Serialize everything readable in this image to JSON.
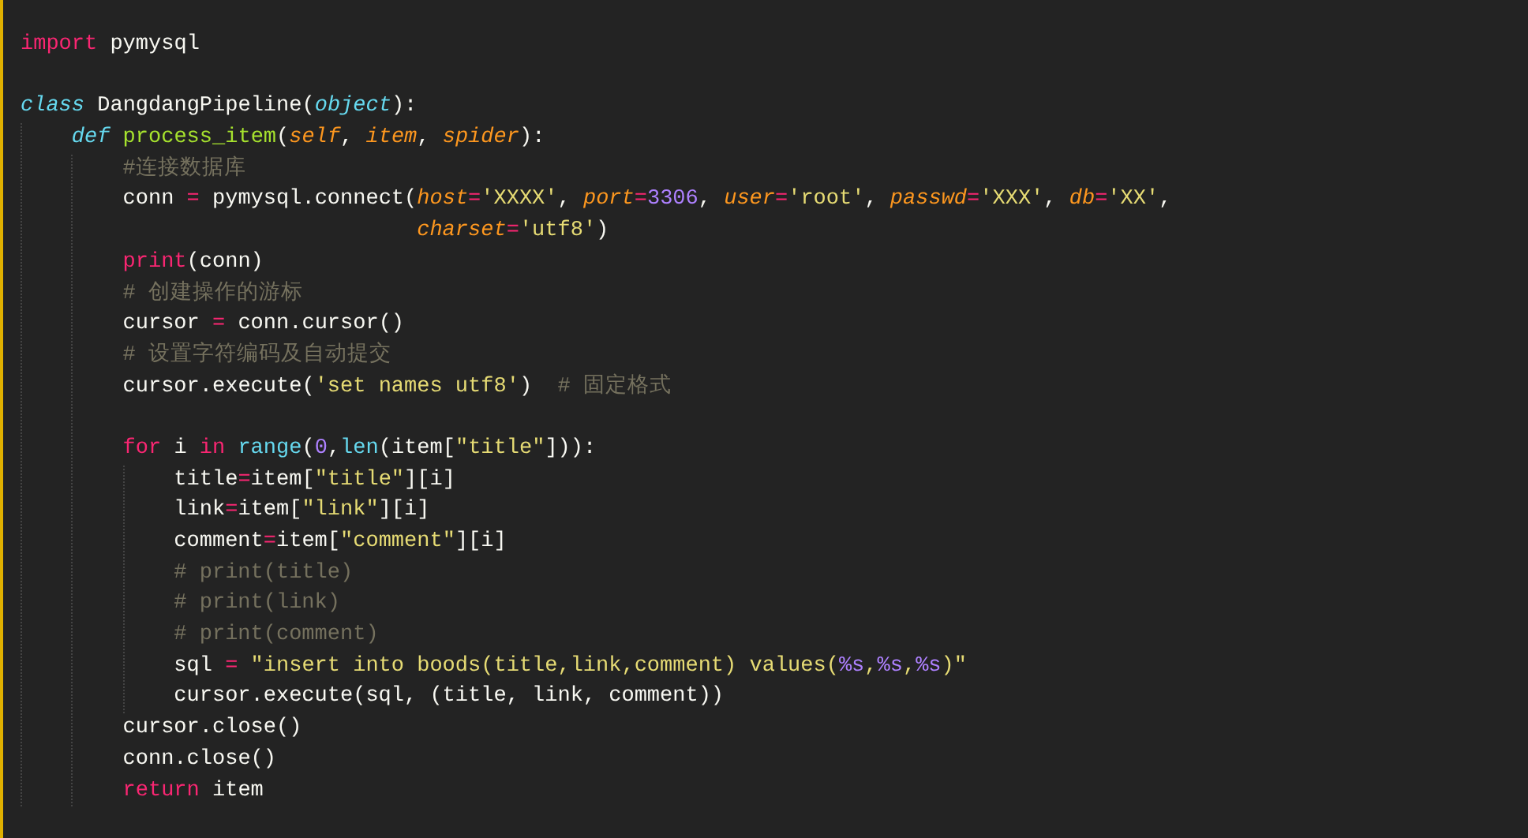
{
  "editor": {
    "lines": [
      {
        "kind": "code",
        "tokens": [
          {
            "kind": "keyword",
            "text": "import"
          },
          {
            "kind": "plain",
            "text": " pymysql"
          }
        ]
      },
      {
        "kind": "blank"
      },
      {
        "kind": "code",
        "tokens": [
          {
            "kind": "storage",
            "text": "class"
          },
          {
            "kind": "plain",
            "text": " DangdangPipeline("
          },
          {
            "kind": "type",
            "text": "object"
          },
          {
            "kind": "plain",
            "text": "):"
          }
        ],
        "children": [
          {
            "kind": "code",
            "tokens": [
              {
                "kind": "storage",
                "text": "def"
              },
              {
                "kind": "function",
                "text": " process_item"
              },
              {
                "kind": "plain",
                "text": "("
              },
              {
                "kind": "param",
                "text": "self"
              },
              {
                "kind": "plain",
                "text": ", "
              },
              {
                "kind": "param",
                "text": "item"
              },
              {
                "kind": "plain",
                "text": ", "
              },
              {
                "kind": "param",
                "text": "spider"
              },
              {
                "kind": "plain",
                "text": "):"
              }
            ],
            "children": [
              {
                "kind": "code",
                "tokens": [
                  {
                    "kind": "comment",
                    "text": "#连接数据库"
                  }
                ]
              },
              {
                "kind": "code",
                "tokens": [
                  {
                    "kind": "plain",
                    "text": "conn "
                  },
                  {
                    "kind": "operator",
                    "text": "="
                  },
                  {
                    "kind": "plain",
                    "text": " pymysql.connect("
                  },
                  {
                    "kind": "param",
                    "text": "host"
                  },
                  {
                    "kind": "operator",
                    "text": "="
                  },
                  {
                    "kind": "string",
                    "text": "'XXXX'"
                  },
                  {
                    "kind": "plain",
                    "text": ", "
                  },
                  {
                    "kind": "param",
                    "text": "port"
                  },
                  {
                    "kind": "operator",
                    "text": "="
                  },
                  {
                    "kind": "number",
                    "text": "3306"
                  },
                  {
                    "kind": "plain",
                    "text": ", "
                  },
                  {
                    "kind": "param",
                    "text": "user"
                  },
                  {
                    "kind": "operator",
                    "text": "="
                  },
                  {
                    "kind": "string",
                    "text": "'root'"
                  },
                  {
                    "kind": "plain",
                    "text": ", "
                  },
                  {
                    "kind": "param",
                    "text": "passwd"
                  },
                  {
                    "kind": "operator",
                    "text": "="
                  },
                  {
                    "kind": "string",
                    "text": "'XXX'"
                  },
                  {
                    "kind": "plain",
                    "text": ", "
                  },
                  {
                    "kind": "param",
                    "text": "db"
                  },
                  {
                    "kind": "operator",
                    "text": "="
                  },
                  {
                    "kind": "string",
                    "text": "'XX'"
                  },
                  {
                    "kind": "plain",
                    "text": ","
                  }
                ]
              },
              {
                "kind": "continuation",
                "tokens": [
                  {
                    "kind": "param",
                    "text": "charset"
                  },
                  {
                    "kind": "operator",
                    "text": "="
                  },
                  {
                    "kind": "string",
                    "text": "'utf8'"
                  },
                  {
                    "kind": "plain",
                    "text": ")"
                  }
                ]
              },
              {
                "kind": "code",
                "tokens": [
                  {
                    "kind": "builtin",
                    "text": "print"
                  },
                  {
                    "kind": "plain",
                    "text": "(conn)"
                  }
                ]
              },
              {
                "kind": "code",
                "tokens": [
                  {
                    "kind": "comment",
                    "text": "# 创建操作的游标"
                  }
                ]
              },
              {
                "kind": "code",
                "tokens": [
                  {
                    "kind": "plain",
                    "text": "cursor "
                  },
                  {
                    "kind": "operator",
                    "text": "="
                  },
                  {
                    "kind": "plain",
                    "text": " conn.cursor()"
                  }
                ]
              },
              {
                "kind": "code",
                "tokens": [
                  {
                    "kind": "comment",
                    "text": "# 设置字符编码及自动提交"
                  }
                ]
              },
              {
                "kind": "code",
                "tokens": [
                  {
                    "kind": "plain",
                    "text": "cursor.execute("
                  },
                  {
                    "kind": "string",
                    "text": "'set names utf8'"
                  },
                  {
                    "kind": "plain",
                    "text": ")  "
                  },
                  {
                    "kind": "comment",
                    "text": "# 固定格式"
                  }
                ]
              },
              {
                "kind": "blank"
              },
              {
                "kind": "code",
                "tokens": [
                  {
                    "kind": "keyword",
                    "text": "for"
                  },
                  {
                    "kind": "plain",
                    "text": " i "
                  },
                  {
                    "kind": "keyword",
                    "text": "in"
                  },
                  {
                    "kind": "support",
                    "text": " range"
                  },
                  {
                    "kind": "plain",
                    "text": "("
                  },
                  {
                    "kind": "number",
                    "text": "0"
                  },
                  {
                    "kind": "plain",
                    "text": ","
                  },
                  {
                    "kind": "support",
                    "text": "len"
                  },
                  {
                    "kind": "plain",
                    "text": "(item["
                  },
                  {
                    "kind": "string",
                    "text": "\"title\""
                  },
                  {
                    "kind": "plain",
                    "text": "])):"
                  }
                ],
                "children": [
                  {
                    "kind": "code",
                    "tokens": [
                      {
                        "kind": "plain",
                        "text": "title"
                      },
                      {
                        "kind": "operator",
                        "text": "="
                      },
                      {
                        "kind": "plain",
                        "text": "item["
                      },
                      {
                        "kind": "string",
                        "text": "\"title\""
                      },
                      {
                        "kind": "plain",
                        "text": "][i]"
                      }
                    ]
                  },
                  {
                    "kind": "code",
                    "tokens": [
                      {
                        "kind": "plain",
                        "text": "link"
                      },
                      {
                        "kind": "operator",
                        "text": "="
                      },
                      {
                        "kind": "plain",
                        "text": "item["
                      },
                      {
                        "kind": "string",
                        "text": "\"link\""
                      },
                      {
                        "kind": "plain",
                        "text": "][i]"
                      }
                    ]
                  },
                  {
                    "kind": "code",
                    "tokens": [
                      {
                        "kind": "plain",
                        "text": "comment"
                      },
                      {
                        "kind": "operator",
                        "text": "="
                      },
                      {
                        "kind": "plain",
                        "text": "item["
                      },
                      {
                        "kind": "string",
                        "text": "\"comment\""
                      },
                      {
                        "kind": "plain",
                        "text": "][i]"
                      }
                    ]
                  },
                  {
                    "kind": "code",
                    "tokens": [
                      {
                        "kind": "comment",
                        "text": "# print(title)"
                      }
                    ]
                  },
                  {
                    "kind": "code",
                    "tokens": [
                      {
                        "kind": "comment",
                        "text": "# print(link)"
                      }
                    ]
                  },
                  {
                    "kind": "code",
                    "tokens": [
                      {
                        "kind": "comment",
                        "text": "# print(comment)"
                      }
                    ]
                  },
                  {
                    "kind": "code",
                    "tokens": [
                      {
                        "kind": "plain",
                        "text": "sql "
                      },
                      {
                        "kind": "operator",
                        "text": "="
                      },
                      {
                        "kind": "string",
                        "text": " \"insert into boods(title,link,comment) values("
                      },
                      {
                        "kind": "number",
                        "text": "%s"
                      },
                      {
                        "kind": "string",
                        "text": ","
                      },
                      {
                        "kind": "number",
                        "text": "%s"
                      },
                      {
                        "kind": "string",
                        "text": ","
                      },
                      {
                        "kind": "number",
                        "text": "%s"
                      },
                      {
                        "kind": "string",
                        "text": ")\""
                      }
                    ]
                  },
                  {
                    "kind": "code",
                    "tokens": [
                      {
                        "kind": "plain",
                        "text": "cursor.execute(sql, (title, link, comment))"
                      }
                    ]
                  }
                ]
              },
              {
                "kind": "code",
                "tokens": [
                  {
                    "kind": "plain",
                    "text": "cursor.close()"
                  }
                ]
              },
              {
                "kind": "code",
                "tokens": [
                  {
                    "kind": "plain",
                    "text": "conn.close()"
                  }
                ]
              },
              {
                "kind": "code",
                "tokens": [
                  {
                    "kind": "keyword",
                    "text": "return"
                  },
                  {
                    "kind": "plain",
                    "text": " item"
                  }
                ]
              }
            ]
          }
        ]
      }
    ]
  }
}
